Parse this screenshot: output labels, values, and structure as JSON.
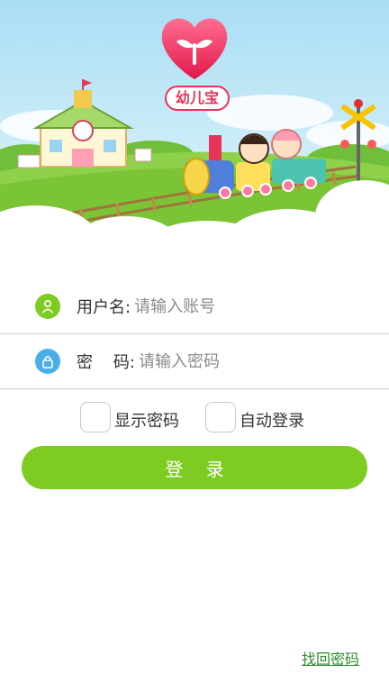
{
  "app": {
    "logo_text": "幼儿宝"
  },
  "form": {
    "username_label": "用户名:",
    "username_placeholder": "请输入账号",
    "password_label": "密    码:",
    "password_placeholder": "请输入密码",
    "show_password_label": "显示密码",
    "auto_login_label": "自动登录",
    "login_button": "登    录",
    "forgot_password": "找回密码"
  },
  "icons": {
    "user": "user-icon",
    "lock": "lock-icon",
    "logo": "heart-sprout-icon"
  },
  "colors": {
    "accent_green": "#7ecb22",
    "brand_pink": "#e8335a",
    "lock_blue": "#4aaee8"
  }
}
